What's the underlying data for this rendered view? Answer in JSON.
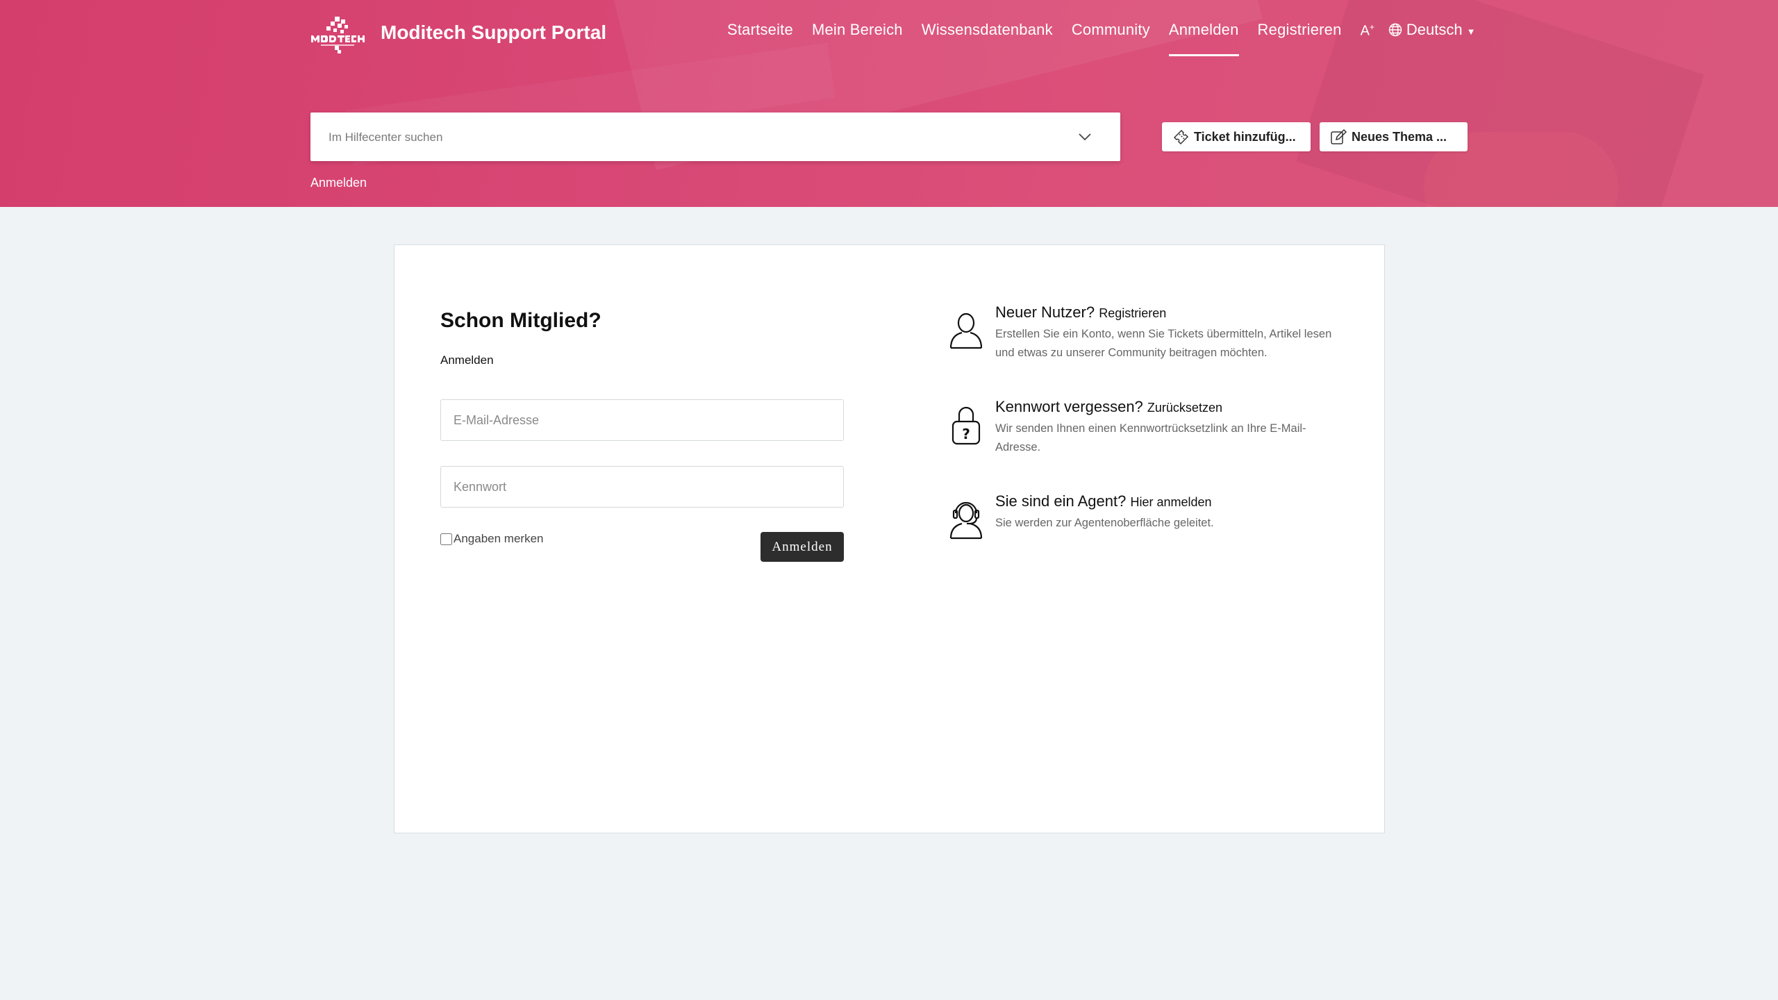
{
  "header": {
    "brand_title": "Moditech Support Portal",
    "nav": {
      "home": "Startseite",
      "my_area": "Mein Bereich",
      "knowledge_base": "Wissensdatenbank",
      "community": "Community",
      "login": "Anmelden",
      "register": "Registrieren",
      "font_size": "A",
      "language": "Deutsch"
    },
    "search": {
      "placeholder": "Im Hilfecenter suchen"
    },
    "add_ticket": "Ticket hinzufüg...",
    "new_topic": "Neues Thema ...",
    "breadcrumb": "Anmelden",
    "accent_color": "#d84775"
  },
  "login": {
    "title": "Schon Mitglied?",
    "subtitle": "Anmelden",
    "email_placeholder": "E-Mail-Adresse",
    "password_placeholder": "Kennwort",
    "remember_label": "Angaben merken",
    "remember_checked": false,
    "submit_label": "Anmelden"
  },
  "info": [
    {
      "icon": "user-icon",
      "heading": "Neuer Nutzer?",
      "link": "Registrieren",
      "description": "Erstellen Sie ein Konto, wenn Sie Tickets übermitteln, Artikel lesen und etwas zu unserer Community beitragen möchten."
    },
    {
      "icon": "lock-question-icon",
      "heading": "Kennwort vergessen?",
      "link": "Zurücksetzen",
      "description": "Wir senden Ihnen einen Kennwortrücksetzlink an Ihre E-Mail-Adresse."
    },
    {
      "icon": "headset-agent-icon",
      "heading": "Sie sind ein Agent?",
      "link": "Hier anmelden",
      "description": "Sie werden zur Agentenoberfläche geleitet."
    }
  ]
}
